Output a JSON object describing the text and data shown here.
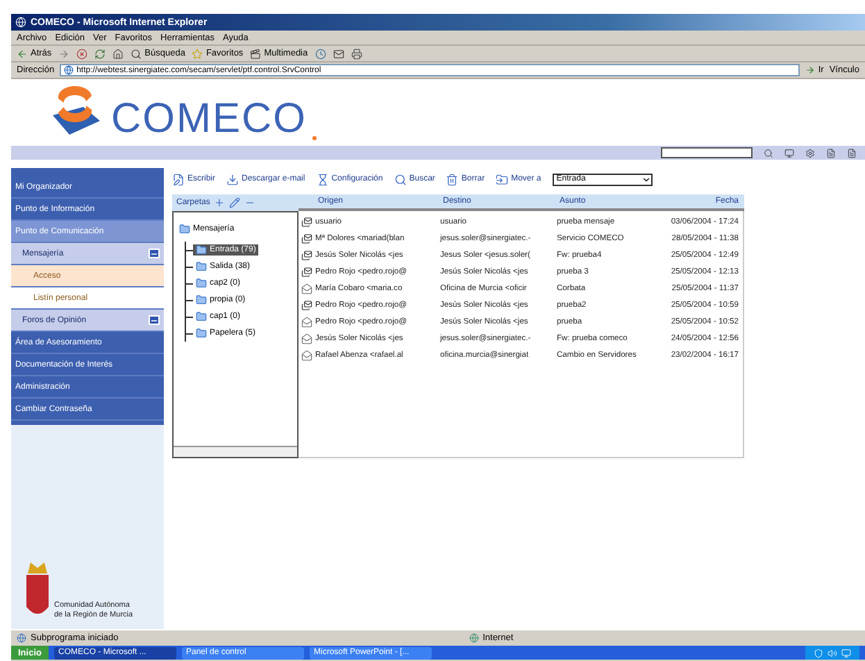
{
  "window": {
    "title": "COMECO - Microsoft Internet Explorer"
  },
  "menu": [
    "Archivo",
    "Edición",
    "Ver",
    "Favoritos",
    "Herramientas",
    "Ayuda"
  ],
  "browser_toolbar": [
    {
      "kind": "back",
      "label": "Atrás"
    },
    {
      "kind": "forward"
    },
    {
      "kind": "stop"
    },
    {
      "kind": "refresh"
    },
    {
      "kind": "home"
    },
    {
      "kind": "search",
      "label": "Búsqueda"
    },
    {
      "kind": "favorites",
      "label": "Favoritos"
    },
    {
      "kind": "media",
      "label": "Multimedia"
    },
    {
      "kind": "history"
    },
    {
      "kind": "mail"
    },
    {
      "kind": "print"
    }
  ],
  "address_bar": {
    "label": "Dirección",
    "url": "http://webtest.sinergiatec.com/secam/servlet/ptf.control.SrvControl",
    "go": "Ir",
    "links": "Vínculo"
  },
  "site": {
    "logo": "COMECO",
    "sidebar": {
      "items": [
        {
          "label": "Mi Organizador",
          "selected": false
        },
        {
          "label": "Punto de Información",
          "selected": false
        },
        {
          "label": "Punto de Comunicación",
          "selected": true,
          "children": [
            {
              "label": "Mensajería",
              "expanded": true,
              "children": [
                {
                  "label": "Acceso",
                  "selected": true
                },
                {
                  "label": "Listín personal",
                  "selected": false
                }
              ]
            },
            {
              "label": "Foros de Opinión",
              "expanded": true
            }
          ]
        },
        {
          "label": "Área de Asesoramiento",
          "selected": false
        },
        {
          "label": "Documentación de Interés",
          "selected": false
        },
        {
          "label": "Administración",
          "selected": false
        },
        {
          "label": "Cambiar Contraseña",
          "selected": false
        }
      ],
      "footer": "Comunidad Autónoma de la Región de Murcia"
    },
    "toolbar": [
      {
        "kind": "compose",
        "label": "Escribir"
      },
      {
        "kind": "download",
        "label": "Descargar e-mail"
      },
      {
        "kind": "settings",
        "label": "Configuración"
      },
      {
        "kind": "search",
        "label": "Buscar"
      },
      {
        "kind": "delete",
        "label": "Borrar"
      },
      {
        "kind": "move",
        "label": "Mover a"
      }
    ],
    "move_target": "Entrada",
    "folders": {
      "title": "Carpetas",
      "root": "Mensajería",
      "children": [
        {
          "label": "Entrada (79)",
          "selected": true
        },
        {
          "label": "Salida (38)",
          "selected": false
        },
        {
          "label": "cap2 (0)",
          "selected": false
        },
        {
          "label": "propia (0)",
          "selected": false
        },
        {
          "label": "cap1 (0)",
          "selected": false
        },
        {
          "label": "Papelera (5)",
          "selected": false
        }
      ]
    },
    "messages": {
      "columns": [
        "Origen",
        "Destino",
        "Asunto",
        "Fecha"
      ],
      "rows": [
        {
          "kind": "replied",
          "cells": [
            "usuario",
            "usuario",
            "prueba mensaje",
            "03/06/2004 - 17:24"
          ]
        },
        {
          "kind": "replied",
          "cells": [
            "Mª Dolores <mariad(blan",
            "jesus.soler@sinergiatec.-",
            "Servicio COMECO",
            "28/05/2004 - 11:38"
          ]
        },
        {
          "kind": "replied",
          "cells": [
            "Jesús Soler Nicolás <jes",
            "Jesus Soler <jesus.soler(",
            "Fw: prueba4",
            "25/05/2004 - 12:49"
          ]
        },
        {
          "kind": "replied",
          "cells": [
            "Pedro Rojo <pedro.rojo@",
            "Jesús Soler Nicolás <jes",
            "prueba 3",
            "25/05/2004 - 12:13"
          ]
        },
        {
          "kind": "read",
          "cells": [
            "María Cobaro <maria.co",
            "Oficina de Murcia <oficir",
            "Corbata",
            "25/05/2004 - 11:37"
          ]
        },
        {
          "kind": "replied",
          "cells": [
            "Pedro Rojo <pedro.rojo@",
            "Jesús Soler Nicolás <jes",
            "prueba2",
            "25/05/2004 - 10:59"
          ]
        },
        {
          "kind": "read",
          "cells": [
            "Pedro Rojo <pedro.rojo@",
            "Jesús Soler Nicolás <jes",
            "prueba",
            "25/05/2004 - 10:52"
          ]
        },
        {
          "kind": "read",
          "cells": [
            "Jesús Soler Nicolás <jes",
            "jesus.soler@sinergiatec.-",
            "Fw: prueba comeco",
            "24/05/2004 - 12:56"
          ]
        },
        {
          "kind": "read",
          "cells": [
            "Rafael Abenza <rafael.al",
            "oficina.murcia@sinergiat",
            "Cambio en Servidores",
            "23/02/2004 - 16:17"
          ]
        }
      ]
    }
  },
  "status_bar": {
    "text": "Subprograma iniciado",
    "zone": "Internet"
  },
  "taskbar": {
    "start": "Inicio",
    "tasks": [
      {
        "label": "COMECO - Microsoft ...",
        "selected": true
      },
      {
        "label": "Panel de control",
        "selected": false
      },
      {
        "label": "Microsoft PowerPoint - [...",
        "selected": false
      }
    ]
  }
}
